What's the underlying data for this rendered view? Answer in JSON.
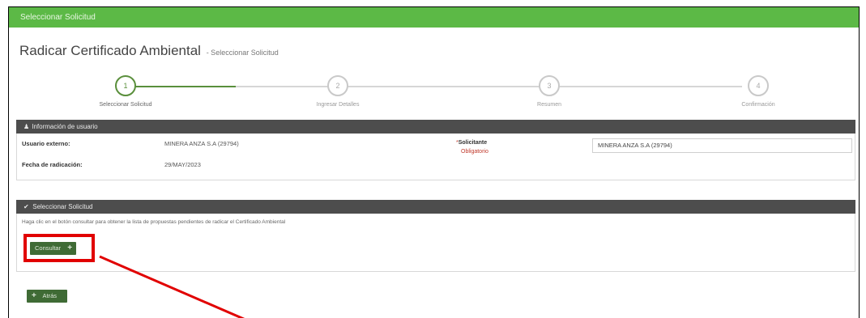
{
  "header": {
    "title": "Seleccionar Solicitud"
  },
  "page": {
    "title": "Radicar Certificado Ambiental",
    "subtitle": "- Seleccionar Solicitud"
  },
  "stepper": {
    "steps": [
      {
        "number": "1",
        "label": "Seleccionar Solicitud",
        "active": true
      },
      {
        "number": "2",
        "label": "Ingresar Detalles",
        "active": false
      },
      {
        "number": "3",
        "label": "Resumen",
        "active": false
      },
      {
        "number": "4",
        "label": "Confirmación",
        "active": false
      }
    ]
  },
  "user_panel": {
    "title": "Información de usuario",
    "icon": "user-icon",
    "fields": [
      {
        "label": "Usuario externo:",
        "value": "MINERA ANZA S.A (29794)"
      },
      {
        "label": "Fecha de radicación:",
        "value": "29/MAY/2023"
      }
    ],
    "solicitante": {
      "label": "Solicitante",
      "required_marker": "*",
      "required_note": "Obligatorio",
      "value": "MINERA ANZA S.A (29794)"
    }
  },
  "request_panel": {
    "title": "Seleccionar Solicitud",
    "icon": "check-icon",
    "help_text": "Haga clic en el botón consultar para obtener la lista de propuestas pendientes de radicar el Certificado Ambiental",
    "consult_button": "Consultar",
    "consult_icon": "plus-icon"
  },
  "footer": {
    "back_button": "Atrás",
    "back_icon": "plus-icon"
  },
  "colors": {
    "topbar": "#5cb946",
    "panel_header": "#4d4d4d",
    "button": "#3f6b35",
    "highlight": "#e10000",
    "step_active": "#5a8f3c"
  }
}
